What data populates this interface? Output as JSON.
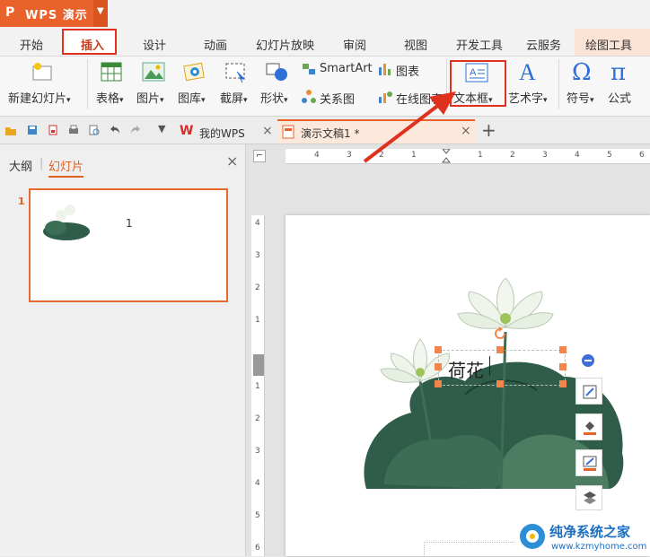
{
  "app": {
    "title": "WPS 演示",
    "logo": "P"
  },
  "menu": {
    "tabs": [
      "开始",
      "插入",
      "设计",
      "动画",
      "幻灯片放映",
      "审阅",
      "视图",
      "开发工具",
      "云服务",
      "绘图工具"
    ],
    "active": "插入"
  },
  "ribbon": {
    "new_slide": "新建幻灯片",
    "table": "表格",
    "picture": "图片",
    "gallery": "图库",
    "screenshot": "截屏",
    "shape": "形状",
    "smartart": "SmartArt",
    "relation": "关系图",
    "chart": "图表",
    "online_chart": "在线图表",
    "textbox": "文本框",
    "wordart": "艺术字",
    "symbol": "符号",
    "formula": "公式",
    "dropdown_caret": "▾"
  },
  "tabs_bar": {
    "my_wps": "我的WPS",
    "doc": "演示文稿1 *",
    "close": "×",
    "add": "+"
  },
  "left_panel": {
    "outline": "大纲",
    "slides": "幻灯片",
    "slide_number": "1",
    "thumb_text": "1",
    "close": "×"
  },
  "slide": {
    "textbox_text": "荷花"
  },
  "ruler": {
    "h_ticks": [
      "4",
      "3",
      "2",
      "1",
      "1",
      "2",
      "3",
      "4",
      "5",
      "6"
    ],
    "v_ticks": [
      "4",
      "3",
      "2",
      "1",
      "1",
      "2",
      "3",
      "4",
      "5",
      "6"
    ]
  },
  "watermark": {
    "title": "纯净系统之家",
    "url": "www.kzmyhome.com"
  },
  "colors": {
    "accent": "#e9622b",
    "highlight": "#e0301e",
    "handle": "#f0864c",
    "leaf": "#2f5d4a"
  }
}
